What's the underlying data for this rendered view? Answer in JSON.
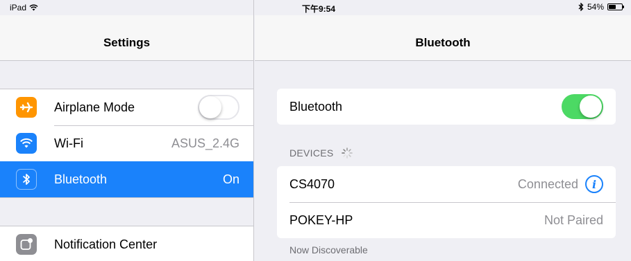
{
  "status_bar": {
    "device": "iPad",
    "time": "下午9:54",
    "battery_text": "54%",
    "battery_level": 0.54
  },
  "settings_pane": {
    "title": "Settings",
    "group1": [
      {
        "label": "Airplane Mode",
        "icon": "airplane-icon",
        "icon_color": "#ff9500",
        "toggle_on": false
      },
      {
        "label": "Wi-Fi",
        "icon": "wifi-icon",
        "icon_color": "#1a82fb",
        "value": "ASUS_2.4G"
      },
      {
        "label": "Bluetooth",
        "icon": "bluetooth-icon",
        "icon_color": "#1a82fb",
        "value": "On",
        "selected": true
      }
    ],
    "group2": [
      {
        "label": "Notification Center",
        "icon": "notification-center-icon",
        "icon_color": "#8e8e93"
      }
    ]
  },
  "bluetooth_pane": {
    "title": "Bluetooth",
    "bluetooth_label": "Bluetooth",
    "bluetooth_on": true,
    "devices_header": "DEVICES",
    "devices": [
      {
        "name": "CS4070",
        "status": "Connected"
      },
      {
        "name": "POKEY-HP",
        "status": "Not Paired"
      }
    ],
    "footer": "Now Discoverable"
  },
  "colors": {
    "accent": "#1a82fb",
    "toggle_on": "#4cd964",
    "airplane": "#ff9500"
  }
}
